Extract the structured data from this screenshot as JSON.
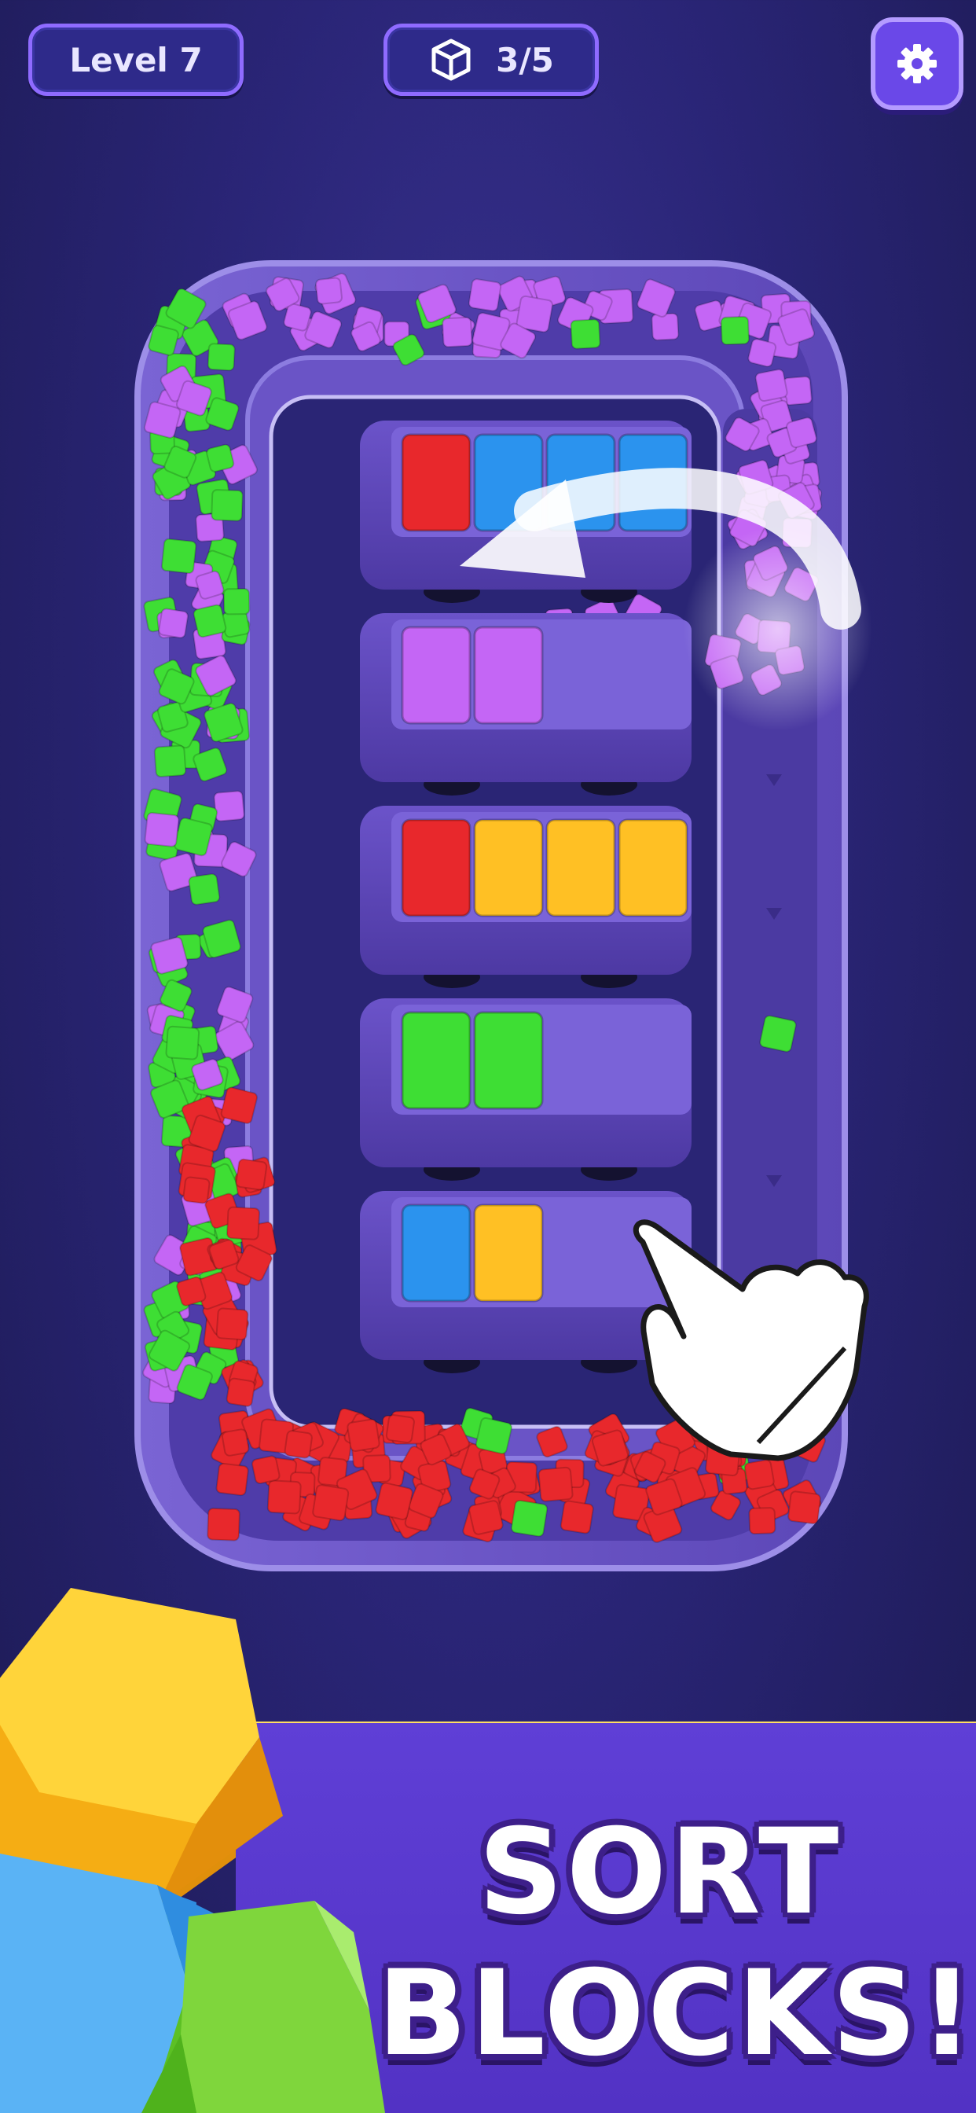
{
  "hud": {
    "level_label": "Level 7",
    "boxes_label": "3/5",
    "boxes_icon": "cube-icon",
    "settings_icon": "gear-icon"
  },
  "colors": {
    "red": "#e8282c",
    "blue": "#2b93ee",
    "yellow": "#ffc024",
    "green": "#3ede34",
    "purple": "#c466f5",
    "truck": "#5b44b8",
    "track": "#6a54c6"
  },
  "trucks": [
    {
      "slots": [
        "red",
        "blue",
        "blue",
        "blue"
      ]
    },
    {
      "slots": [
        "purple",
        "purple"
      ]
    },
    {
      "slots": [
        "red",
        "yellow",
        "yellow",
        "yellow"
      ]
    },
    {
      "slots": [
        "green",
        "green"
      ]
    },
    {
      "slots": [
        "blue",
        "yellow"
      ]
    }
  ],
  "promo": {
    "line1": "SORT",
    "line2": "BLOCKS!"
  },
  "hint": {
    "arrow_icon": "curved-arrow-icon",
    "hand_icon": "pointing-hand-icon"
  }
}
